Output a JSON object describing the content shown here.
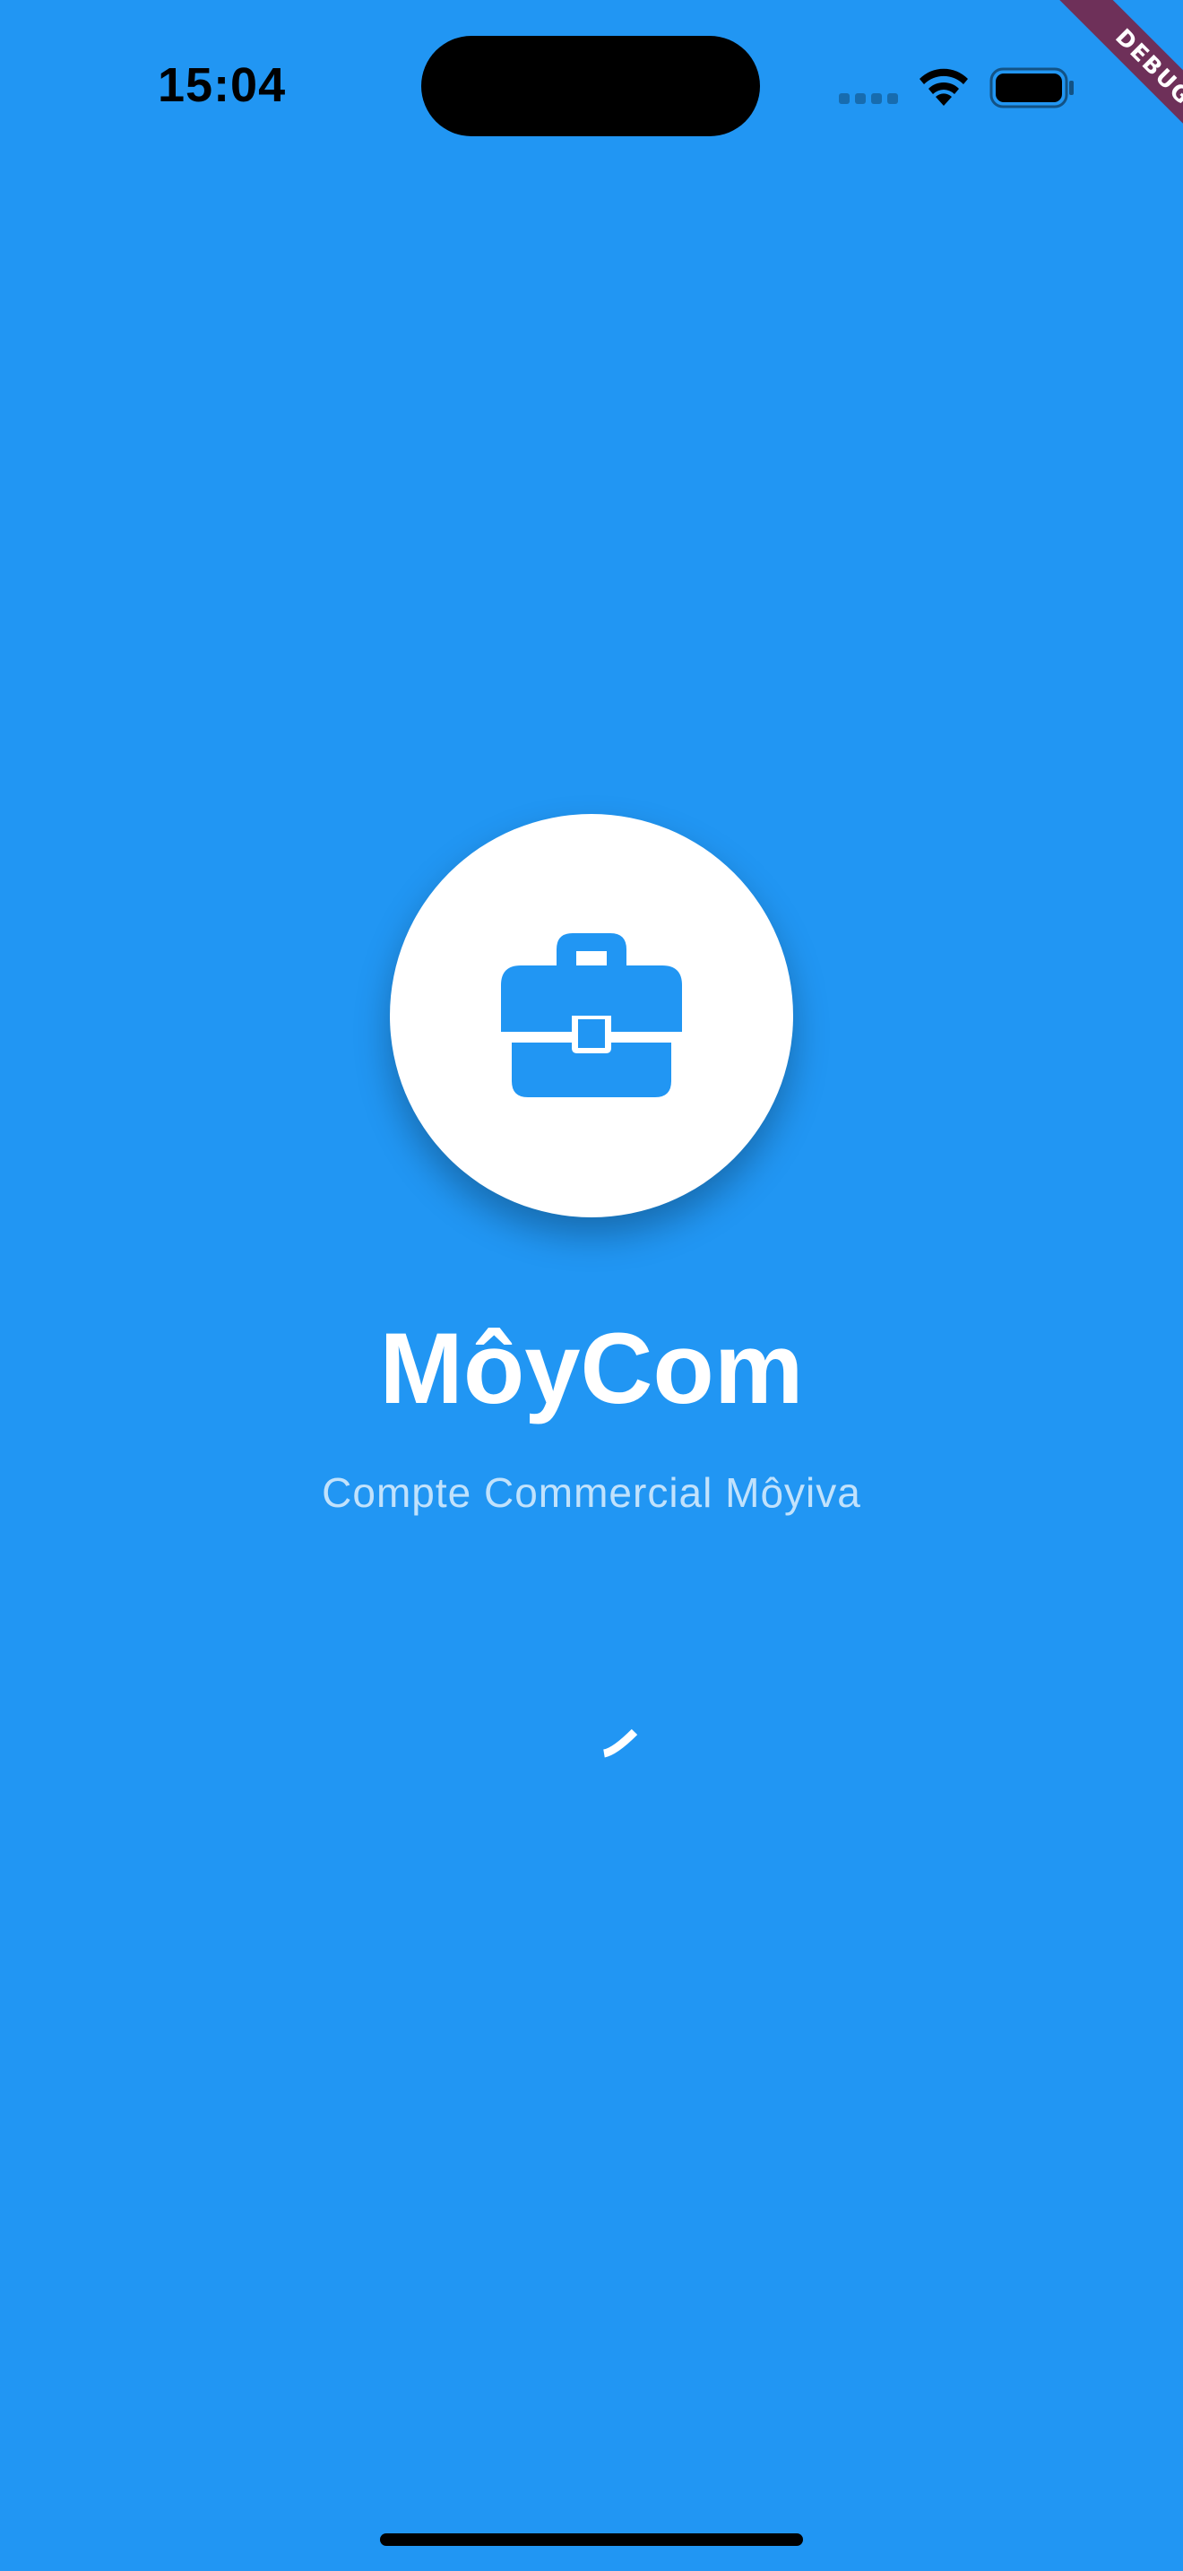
{
  "status_bar": {
    "time": "15:04"
  },
  "debug_banner": {
    "label": "DEBUG"
  },
  "splash": {
    "logo_icon": "briefcase-icon",
    "app_name": "MôyCom",
    "tagline": "Compte Commercial Môyiva"
  },
  "colors": {
    "background": "#2196F3",
    "logo_circle": "#FFFFFF",
    "icon": "#2196F3",
    "text": "#FFFFFF"
  }
}
